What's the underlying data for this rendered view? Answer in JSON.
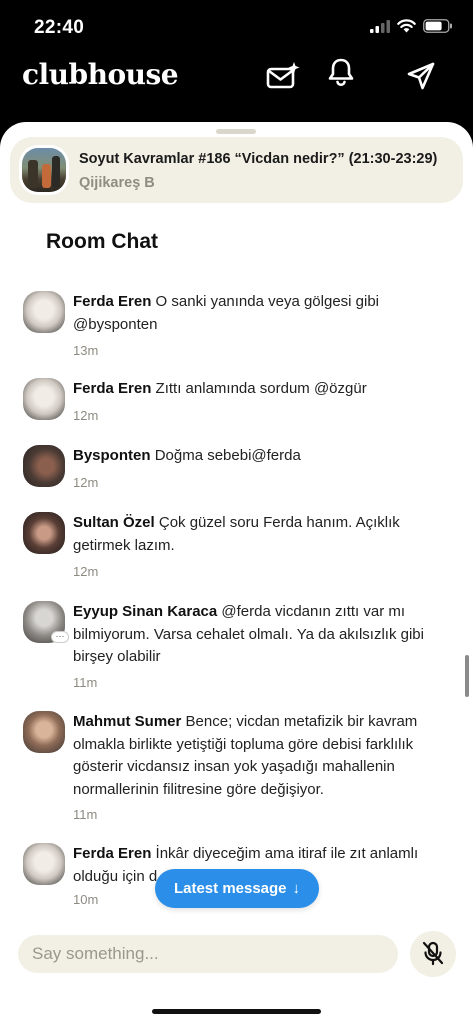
{
  "status": {
    "time": "22:40"
  },
  "header": {
    "brand": "clubhouse"
  },
  "room": {
    "title": "Soyut Kavramlar #186 “Vicdan nedir?” (21:30-23:29)",
    "club": "Qijikareş B"
  },
  "chat": {
    "heading": "Room Chat",
    "messages": [
      {
        "name": "Ferda Eren",
        "text": "O sanki yanında veya gölgesi gibi @bysponten",
        "time": "13m"
      },
      {
        "name": "Ferda Eren",
        "text": "Zıttı anlamında sordum @özgür",
        "time": "12m"
      },
      {
        "name": "Bysponten",
        "text": "Doğma sebebi@ferda",
        "time": "12m"
      },
      {
        "name": "Sultan Özel",
        "text": "Çok güzel soru Ferda hanım. Açıklık getirmek lazım.",
        "time": "12m"
      },
      {
        "name": "Eyyup Sinan Karaca",
        "text": "@ferda vicdanın zıttı var mı bilmiyorum. Varsa cehalet olmalı. Ya da akılsızlık gibi birşey olabilir",
        "time": "11m"
      },
      {
        "name": "Mahmut Sumer",
        "text": "Bence; vicdan metafizik bir kavram olmakla birlikte yetiştiği topluma göre debisi farklılık gösterir vicdansız insan yok yaşadığı mahallenin normallerinin filitresine göre değişiyor.",
        "time": "11m"
      },
      {
        "name": "Ferda Eren",
        "text": "İnkâr diyeceğim ama itiraf ile zıt anlamlı olduğu için d",
        "time": "10m"
      }
    ],
    "more_badge": "···",
    "latest_button": "Latest message",
    "latest_arrow": "↓"
  },
  "composer": {
    "placeholder": "Say something..."
  },
  "colors": {
    "accent": "#2b8ee8",
    "card": "#f2f0e4",
    "muted": "#8d8b80"
  },
  "icons": [
    "signal-icon",
    "wifi-icon",
    "battery-icon",
    "invite-mail-icon",
    "bell-icon",
    "paper-plane-icon",
    "arrow-down-icon",
    "mic-off-icon"
  ]
}
